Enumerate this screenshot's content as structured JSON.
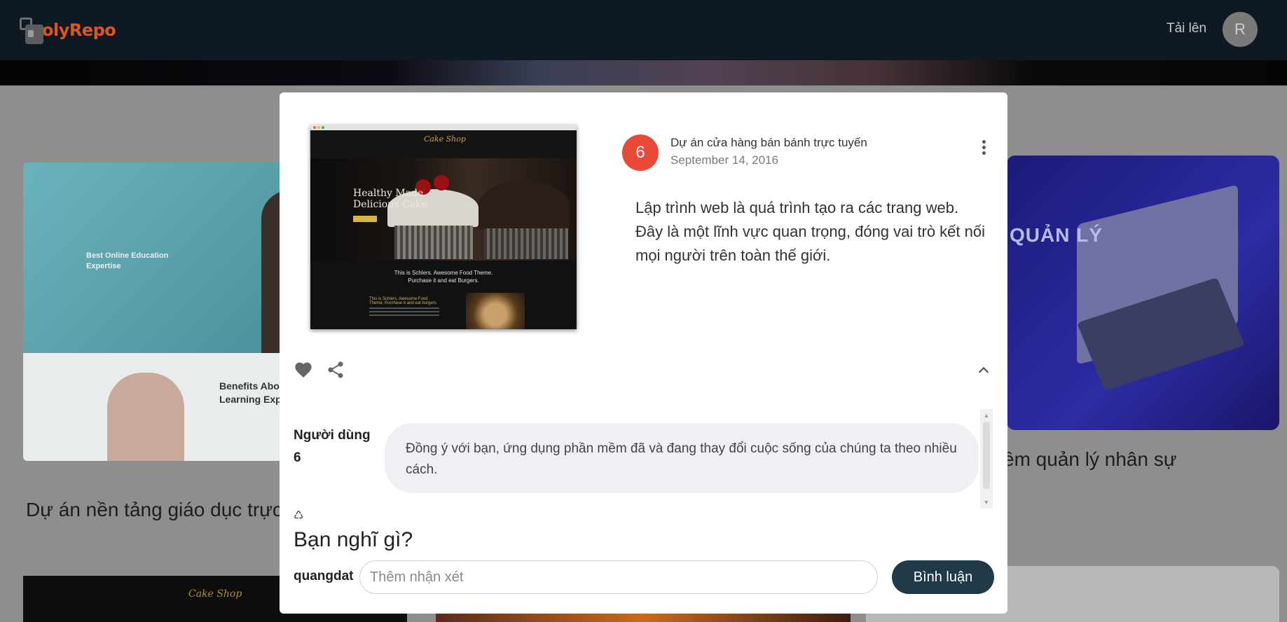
{
  "header": {
    "logo_text": "olyRepo",
    "upload_label": "Tải lên",
    "avatar_initial": "R"
  },
  "background": {
    "left_card": {
      "headline": "Best Online Education Expertise",
      "benefits": "Benefits About Learning Exper"
    },
    "right_card": {
      "label": "QUẢN LÝ"
    },
    "left_caption": "Dự án nền tảng giáo dục trực",
    "right_caption": "ềm quản lý nhân sự",
    "bottom_left_brand": "Cake Shop"
  },
  "modal": {
    "preview": {
      "brand": "Cake Shop",
      "hero_text_line1": "Healthy Made",
      "hero_text_line2": "Delicious Cake",
      "tagline_line1": "This is Schlers. Awesome Food Theme.",
      "tagline_line2": "Purchase it and eat Burgers.",
      "mini_title": "This is Schlers. Awesome Food Theme, Purchase it and eat burgers"
    },
    "badge_number": "6",
    "project_title": "Dự án cửa hàng bán bánh trực tuyến",
    "project_date": "September 14, 2016",
    "description": "Lập trình web là quá trình tạo ra các trang web. Đây là một lĩnh vực quan trọng, đóng vai trò kết nối mọi người trên toàn thế giới.",
    "comments": [
      {
        "user": "Người dùng 6",
        "text": "Đồng ý với bạn, ứng dụng phần mềm đã và đang thay đổi cuộc sống của chúng ta theo nhiều cách."
      }
    ],
    "compose": {
      "heading": "Bạn nghĩ gì?",
      "current_user": "quangdat",
      "placeholder": "Thêm nhận xét",
      "submit_label": "Bình luận"
    }
  },
  "colors": {
    "topbar": "#0f1923",
    "brand_orange": "#d9581f",
    "badge_red": "#e84a37",
    "submit_button": "#213a48"
  }
}
